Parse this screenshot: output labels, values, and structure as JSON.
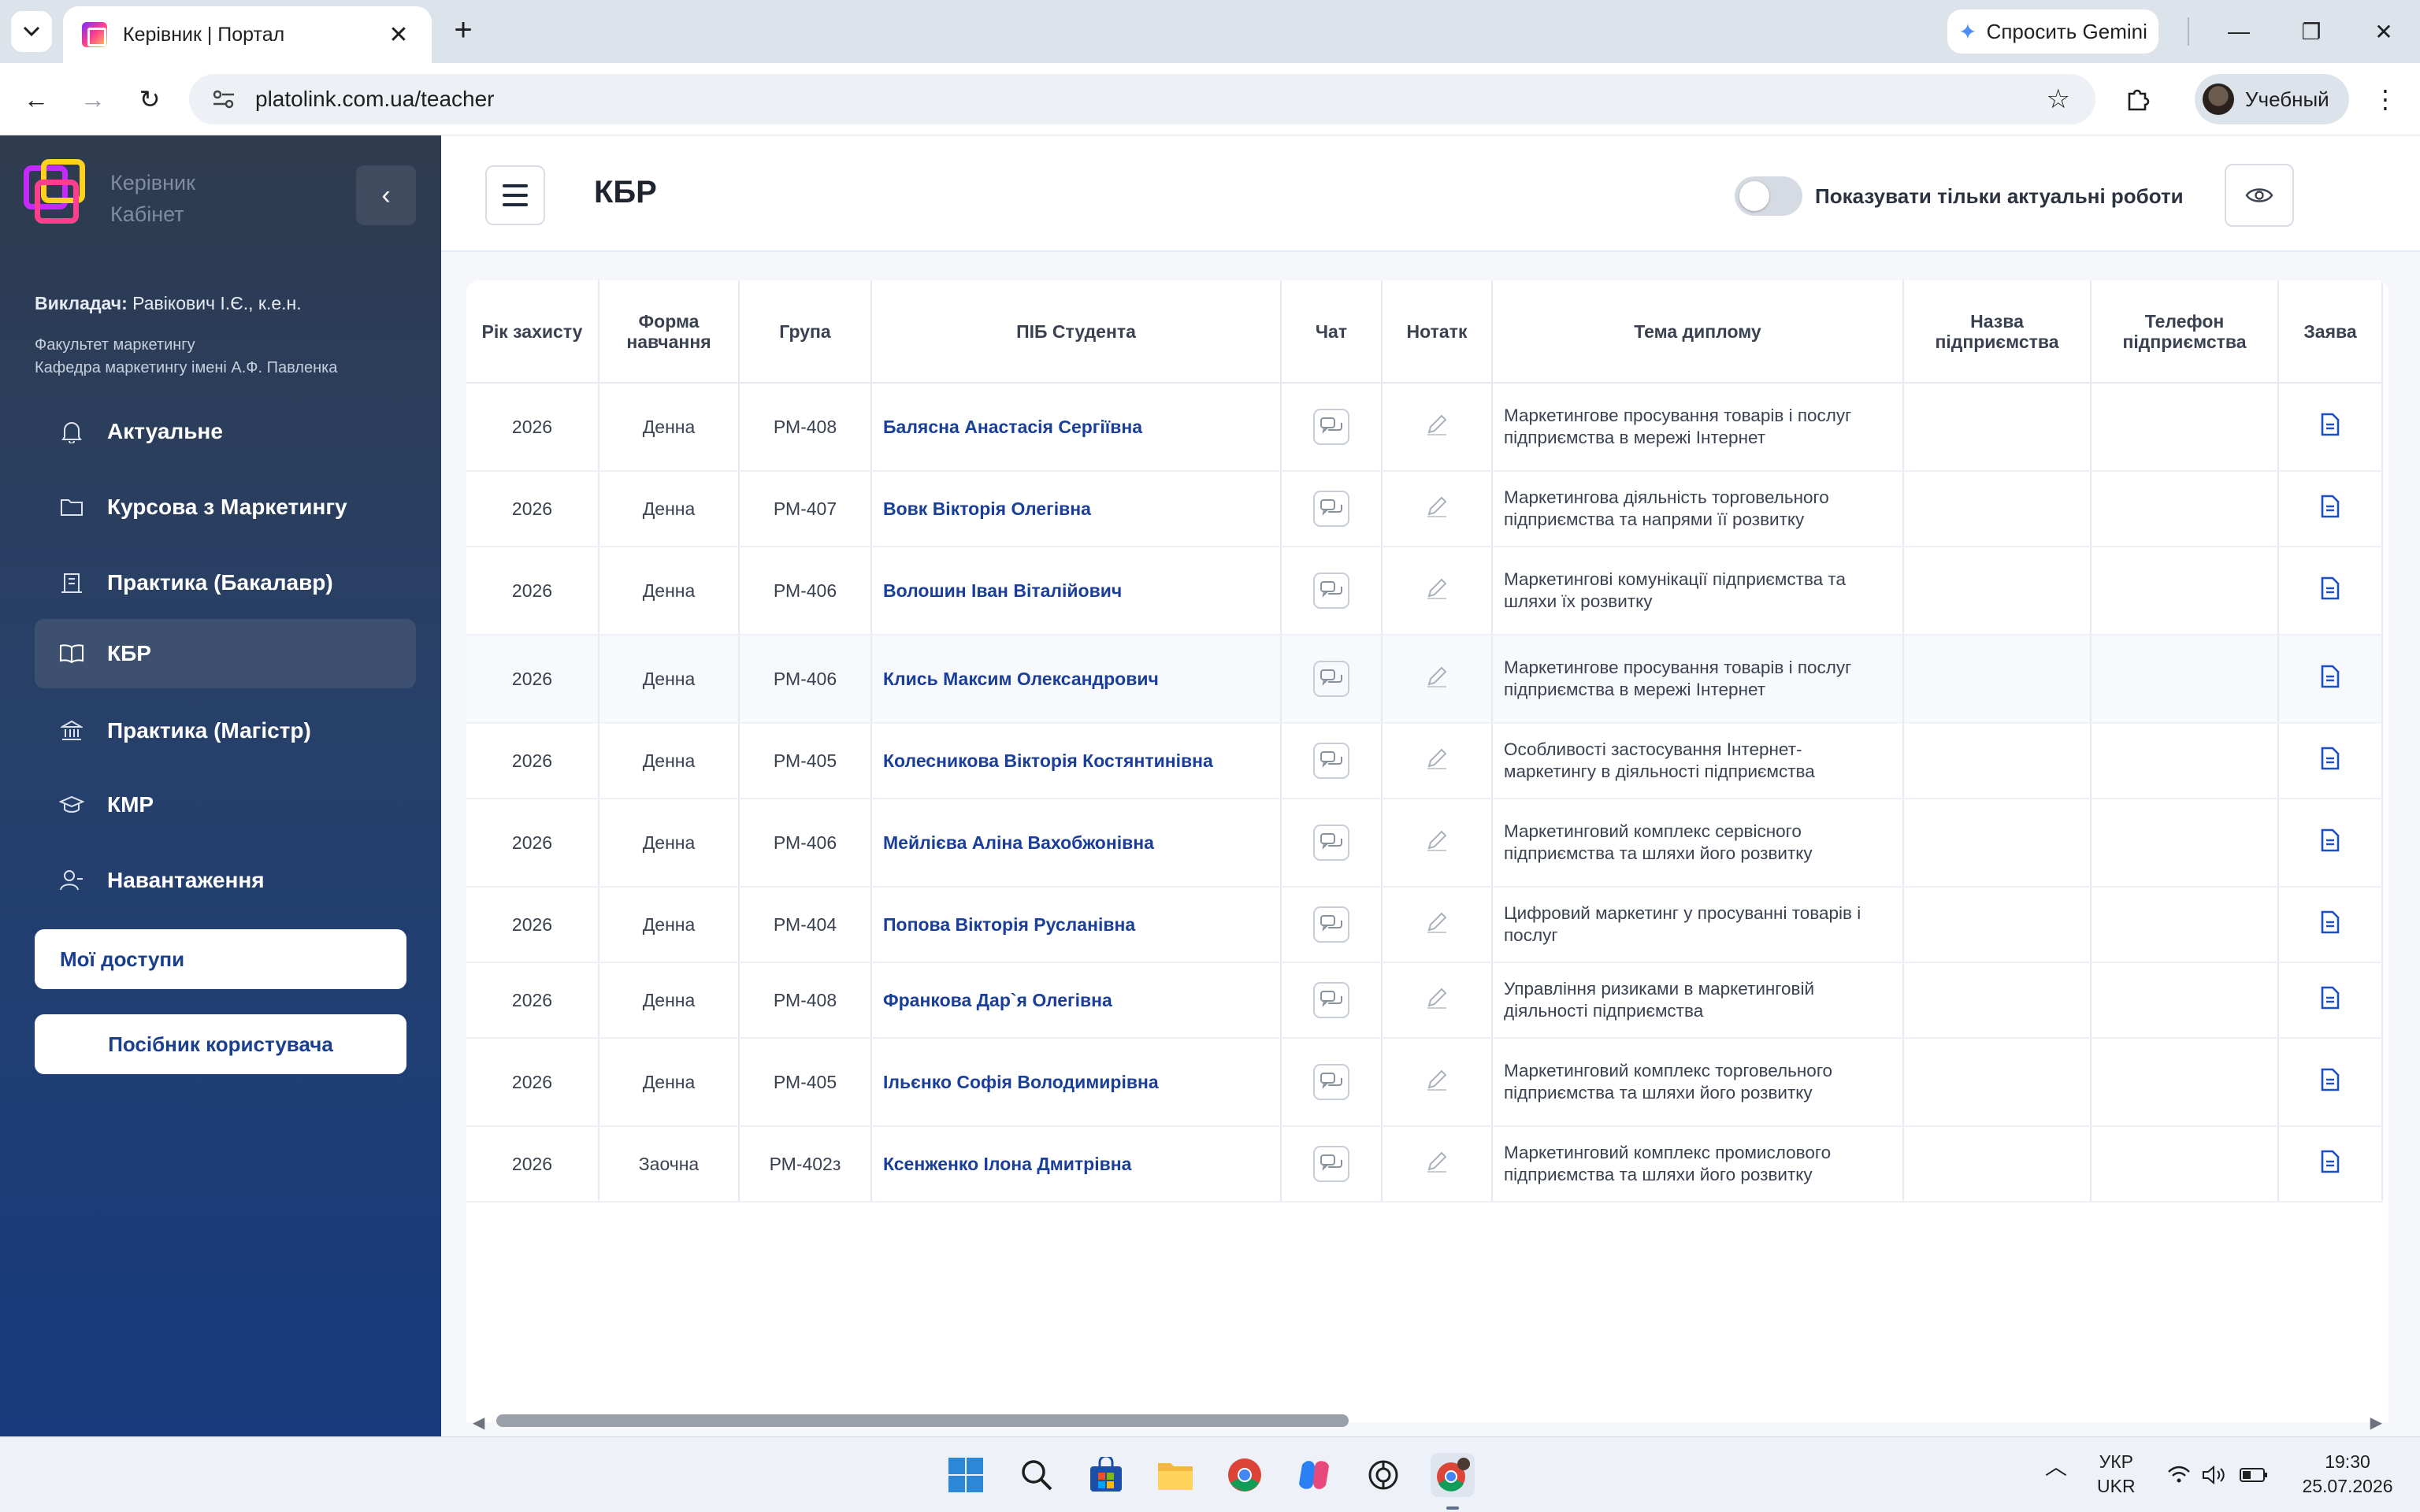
{
  "browser": {
    "tab_title": "Керівник | Портал",
    "url": "platolink.com.ua/teacher",
    "gemini_label": "Спросить Gemini",
    "profile_name": "Учебный"
  },
  "sidebar": {
    "brand_line1": "Керівник",
    "brand_line2": "Кабінет",
    "teacher_label": "Викладач:",
    "teacher_name": "Равікович І.Є., к.е.н.",
    "faculty": "Факультет маркетингу",
    "department": "Кафедра маркетингу імені А.Ф. Павленка",
    "items": [
      {
        "label": "Актуальне",
        "icon": "bell-icon"
      },
      {
        "label": "Курсова з Маркетингу",
        "icon": "folder-icon"
      },
      {
        "label": "Практика (Бакалавр)",
        "icon": "building-icon"
      },
      {
        "label": "КБР",
        "icon": "book-icon"
      },
      {
        "label": "Практика (Магістр)",
        "icon": "bank-icon"
      },
      {
        "label": "КМР",
        "icon": "graduation-cap-icon"
      },
      {
        "label": "Навантаження",
        "icon": "user-icon"
      }
    ],
    "my_access": "Мої доступи",
    "user_guide": "Посібник користувача"
  },
  "header": {
    "title": "КБР",
    "toggle_label": "Показувати тільки актуальні роботи",
    "toggle_on": false
  },
  "table": {
    "columns": [
      "Рік захисту",
      "Форма навчання",
      "Група",
      "ПІБ Студента",
      "Чат",
      "Нотатк",
      "Тема диплому",
      "Назва підприємства",
      "Телефон підприємства",
      "Заява"
    ],
    "rows": [
      {
        "year": "2026",
        "form": "Денна",
        "group": "РМ-408",
        "name": "Балясна Анастасія Сергіївна",
        "topic": "Маркетингове просування товарів і послуг підприємства в мережі Інтернет",
        "company": "",
        "phone": ""
      },
      {
        "year": "2026",
        "form": "Денна",
        "group": "РМ-407",
        "name": "Вовк Вікторія Олегівна",
        "topic": "Маркетингова діяльність торговельного підприємства та напрями її розвитку",
        "company": "",
        "phone": ""
      },
      {
        "year": "2026",
        "form": "Денна",
        "group": "РМ-406",
        "name": "Волошин Іван Віталійович",
        "topic": "Маркетингові комунікації підприємства та шляхи їх розвитку",
        "company": "",
        "phone": ""
      },
      {
        "year": "2026",
        "form": "Денна",
        "group": "РМ-406",
        "name": "Клись Максим Олександрович",
        "topic": "Маркетингове просування товарів і послуг підприємства в мережі Інтернет",
        "company": "",
        "phone": ""
      },
      {
        "year": "2026",
        "form": "Денна",
        "group": "РМ-405",
        "name": "Колесникова Вікторія Костянтинівна",
        "topic": "Особливості застосування Інтернет-маркетингу в діяльності підприємства",
        "company": "",
        "phone": ""
      },
      {
        "year": "2026",
        "form": "Денна",
        "group": "РМ-406",
        "name": "Мейлієва Аліна Вахобжонівна",
        "topic": "Маркетинговий комплекс сервісного підприємства та шляхи його розвитку",
        "company": "",
        "phone": ""
      },
      {
        "year": "2026",
        "form": "Денна",
        "group": "РМ-404",
        "name": "Попова Вікторія Русланівна",
        "topic": "Цифровий маркетинг у просуванні товарів і послуг",
        "company": "",
        "phone": ""
      },
      {
        "year": "2026",
        "form": "Денна",
        "group": "РМ-408",
        "name": "Франкова Дар`я Олегівна",
        "topic": "Управління ризиками в маркетинговій діяльності підприємства",
        "company": "",
        "phone": ""
      },
      {
        "year": "2026",
        "form": "Денна",
        "group": "РМ-405",
        "name": "Ільєнко Софія Володимирівна",
        "topic": "Маркетинговий комплекс торговельного підприємства та шляхи його розвитку",
        "company": "",
        "phone": ""
      },
      {
        "year": "2026",
        "form": "Заочна",
        "group": "РМ-402з",
        "name": "Ксенженко Ілона Дмитрівна",
        "topic": "Маркетинговий комплекс промислового підприємства та шляхи його розвитку",
        "company": "",
        "phone": ""
      }
    ]
  },
  "taskbar": {
    "lang_top": "УКР",
    "lang_bottom": "UKR",
    "time": "19:30",
    "date": "25.07.2026"
  },
  "colors": {
    "link": "#1a3f9a",
    "sidebar_active": "#3e5070",
    "doc_icon": "#1b4fc8"
  }
}
